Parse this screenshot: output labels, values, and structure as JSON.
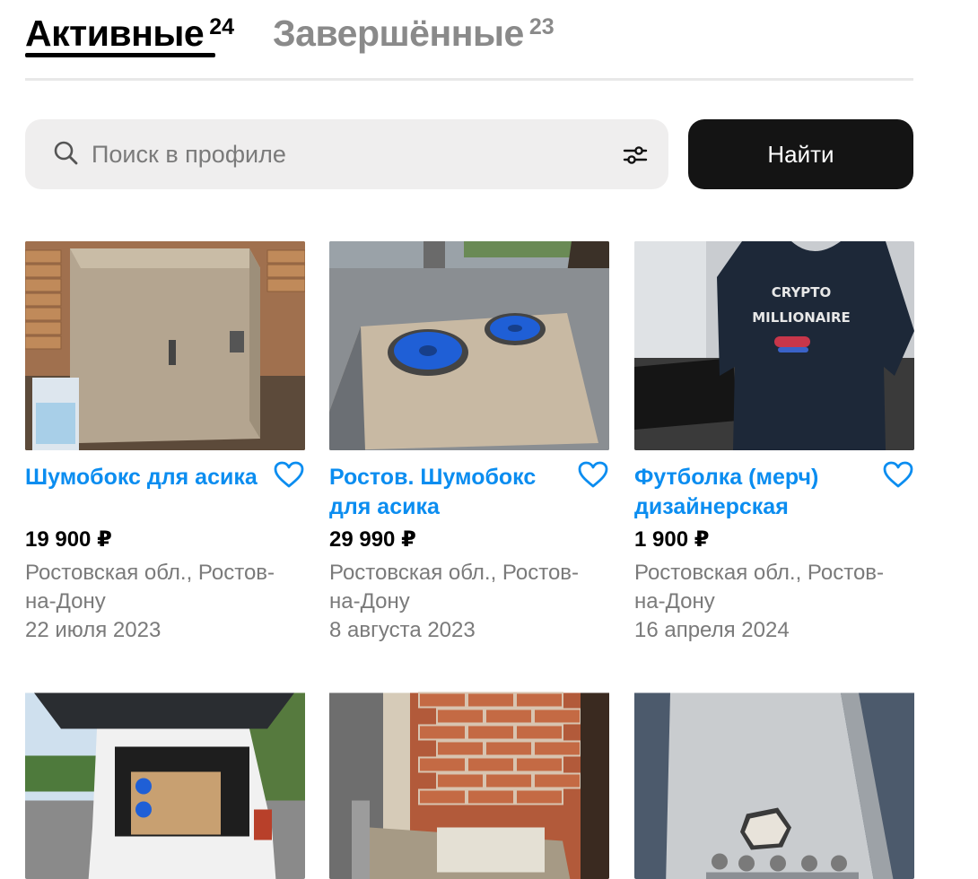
{
  "tabs": [
    {
      "label": "Активные",
      "count": "24",
      "active": true
    },
    {
      "label": "Завершённые",
      "count": "23",
      "active": false
    }
  ],
  "search": {
    "placeholder": "Поиск в профиле",
    "value": "",
    "button_label": "Найти"
  },
  "colors": {
    "accent_link": "#0b8df0",
    "button_dark": "#141414",
    "search_bg": "#efeeee",
    "muted_text": "#7a7a7a"
  },
  "icons": {
    "search": "search-icon",
    "filter": "filter-icon",
    "favorite": "heart-icon"
  },
  "listings": [
    {
      "title": "Шумобокс для асика",
      "price": "19 900 ₽",
      "location": "Ростовская обл., Ростов-на-Дону",
      "date": "22 июля 2023"
    },
    {
      "title": "Ростов. Шумобокс для асика",
      "price": "29 990 ₽",
      "location": "Ростовская обл., Ростов-на-Дону",
      "date": "8 августа 2023"
    },
    {
      "title": "Футболка (мерч) дизайнерская",
      "price": "1 900 ₽",
      "location": "Ростовская обл., Ростов-на-Дону",
      "date": "16 апреля 2024"
    },
    {
      "title": "",
      "price": "",
      "location": "",
      "date": ""
    },
    {
      "title": "",
      "price": "",
      "location": "",
      "date": ""
    },
    {
      "title": "",
      "price": "",
      "location": "",
      "date": ""
    }
  ],
  "image_text": {
    "tshirt_line1": "CRYPTO",
    "tshirt_line2": "MILLIONAIRE"
  }
}
